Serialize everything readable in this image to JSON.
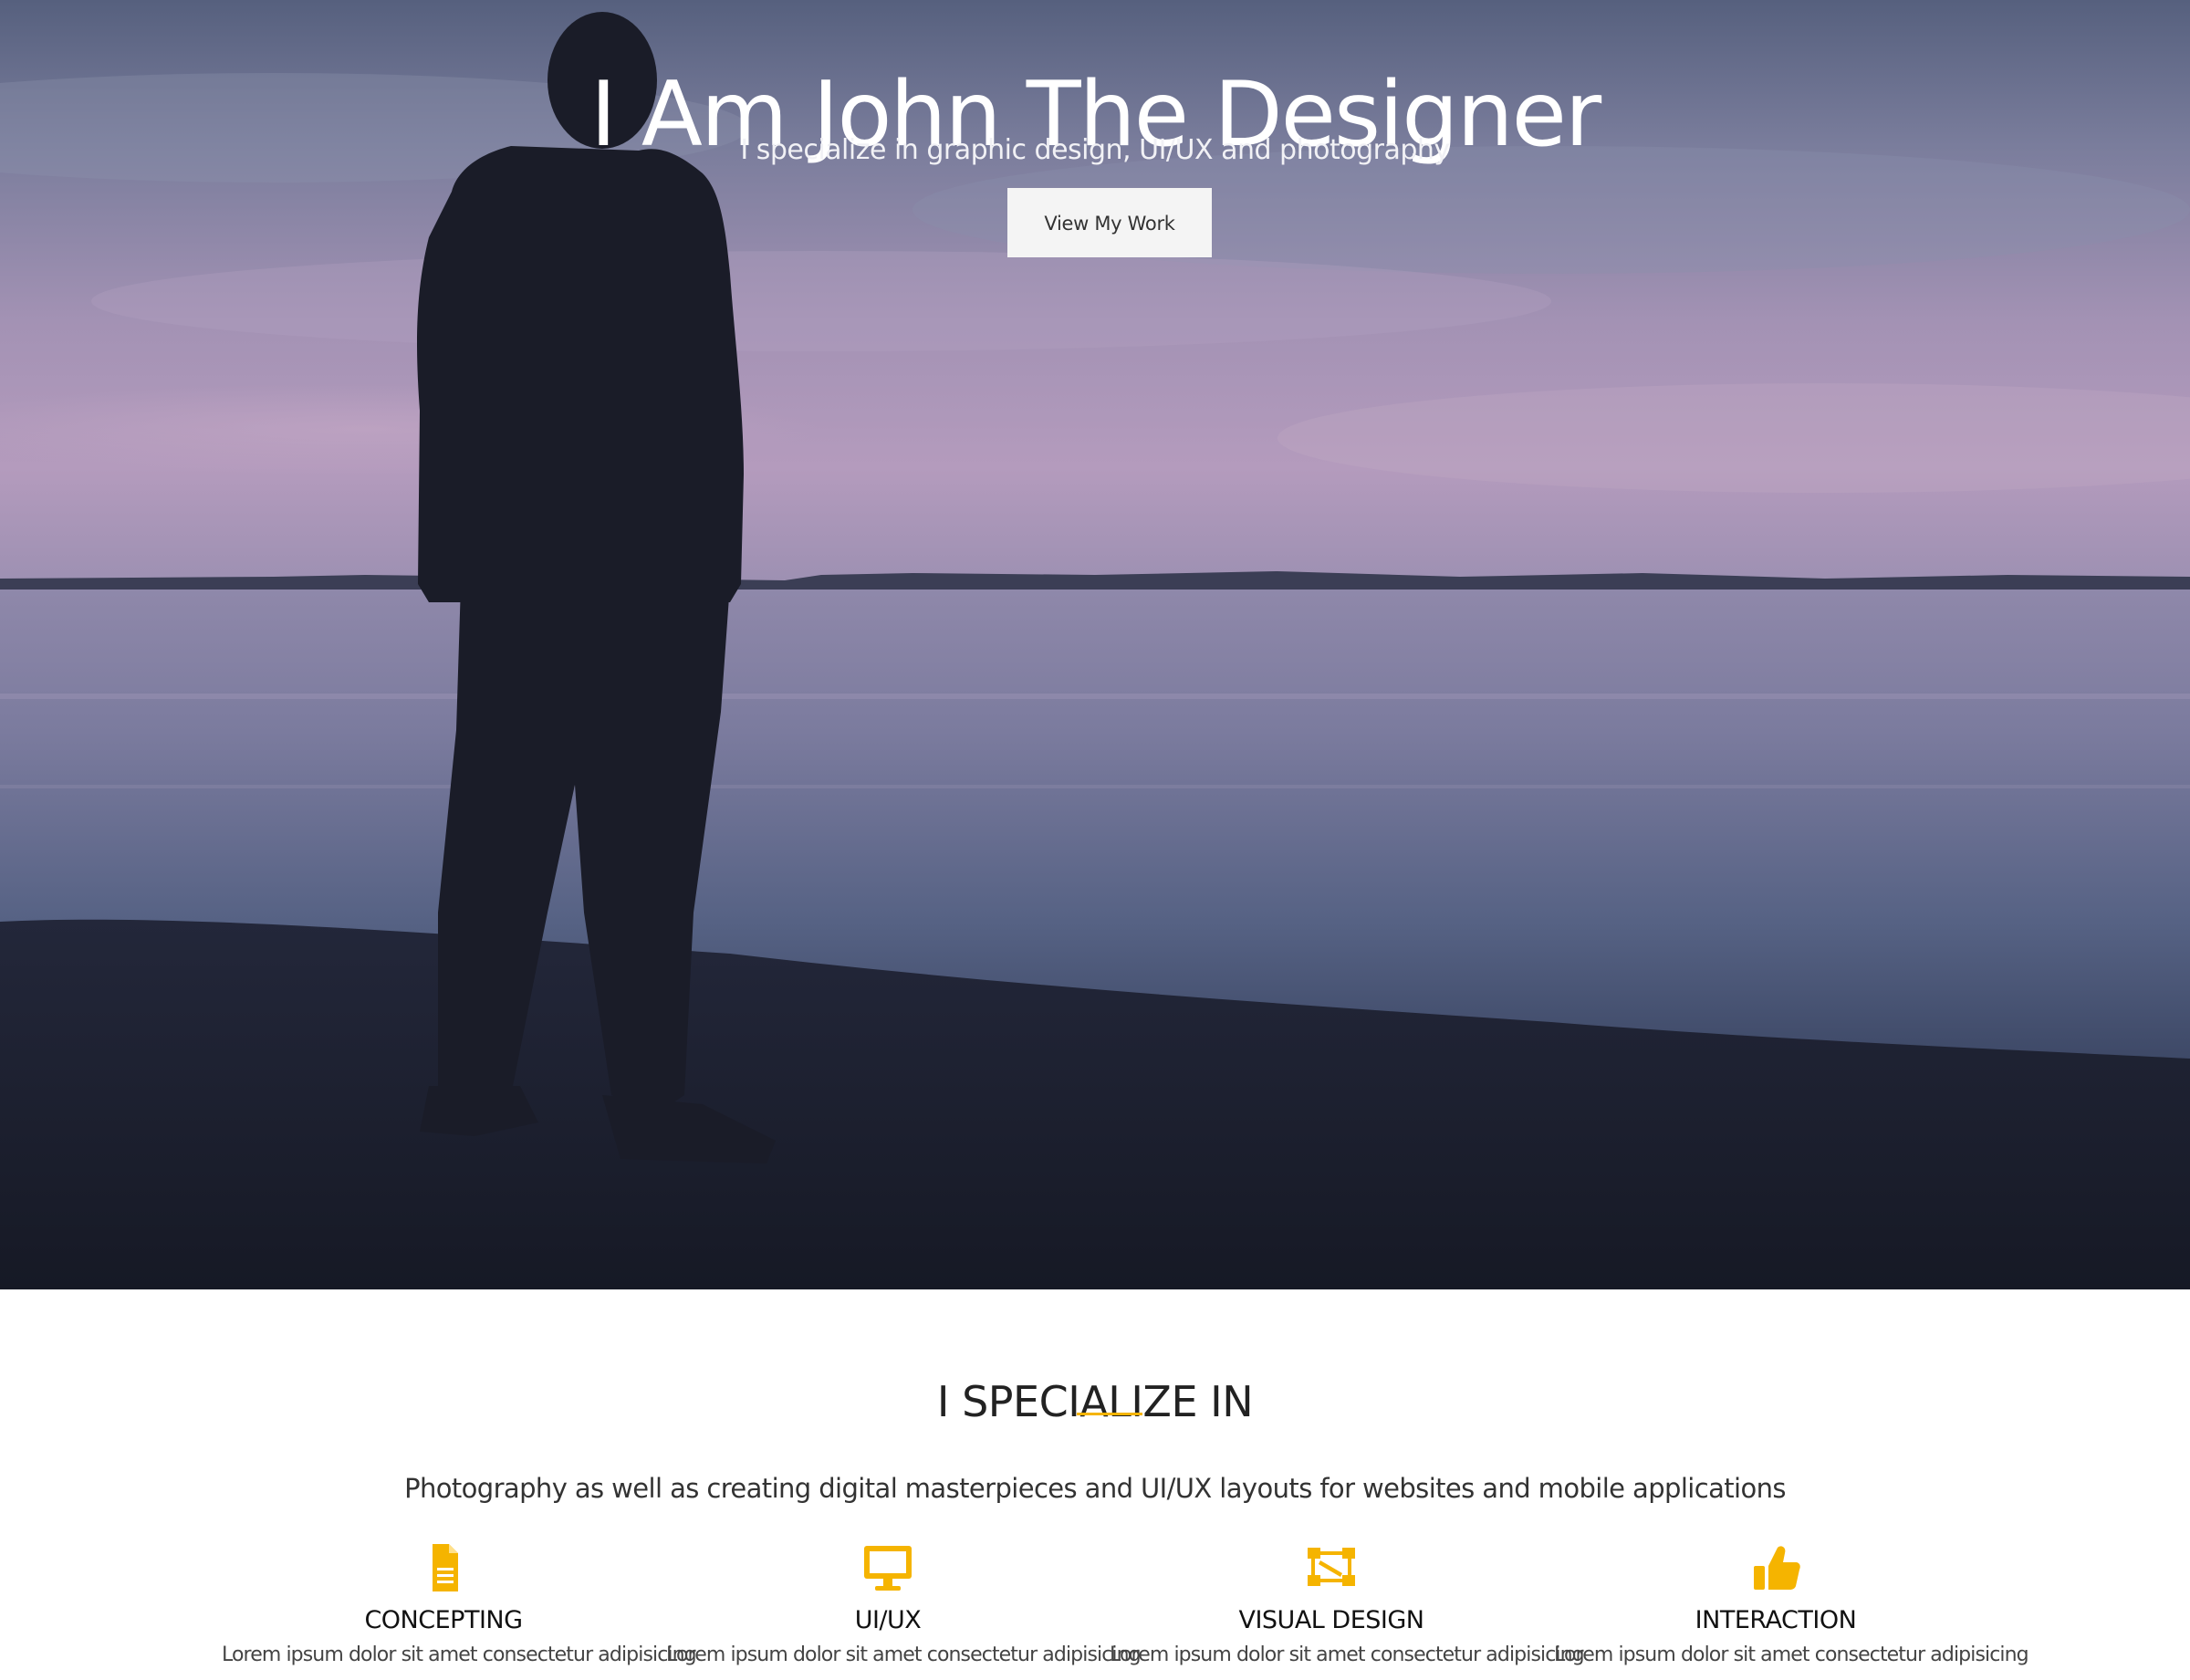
{
  "hero": {
    "title": "I Am John The Designer",
    "subtitle": "I specialize in graphic design, UI/UX and photography",
    "button_label": "View My Work"
  },
  "specialize": {
    "title": "I SPECIALIZE IN",
    "description": "Photography as well as creating digital masterpieces and UI/UX layouts for websites and mobile applications",
    "accent_color": "#f5b400",
    "features": [
      {
        "icon": "document-icon",
        "title": "CONCEPTING",
        "text": "Lorem ipsum dolor sit amet consectetur adipisicing"
      },
      {
        "icon": "monitor-icon",
        "title": "UI/UX",
        "text": "Lorem ipsum dolor sit amet consectetur adipisicing"
      },
      {
        "icon": "vector-design-icon",
        "title": "VISUAL DESIGN",
        "text": "Lorem ipsum dolor sit amet consectetur adipisicing"
      },
      {
        "icon": "thumbs-up-icon",
        "title": "INTERACTION",
        "text": "Lorem ipsum dolor sit amet consectetur adipisicing"
      }
    ]
  }
}
